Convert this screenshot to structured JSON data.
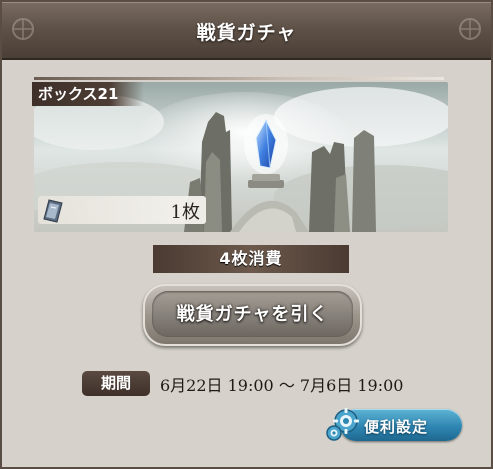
{
  "window": {
    "title": "戦貨ガチャ"
  },
  "box": {
    "label": "ボックス21",
    "ticket_count": "1枚"
  },
  "cost": {
    "label": "4枚消費"
  },
  "draw_button": {
    "label": "戦貨ガチャを引く"
  },
  "period": {
    "tag": "期間",
    "text": "6月22日 19:00 ～ 7月6日 19:00"
  },
  "settings_button": {
    "label": "便利設定"
  },
  "colors": {
    "title_bar": "#5f5248",
    "panel_bg": "#d6d2cb",
    "settings_blue": "#2e86b2",
    "cost_bar": "#6c594c"
  },
  "icons": {
    "ticket": "ticket-icon",
    "settings": "gear-icon",
    "crystal": "crystal-icon"
  }
}
